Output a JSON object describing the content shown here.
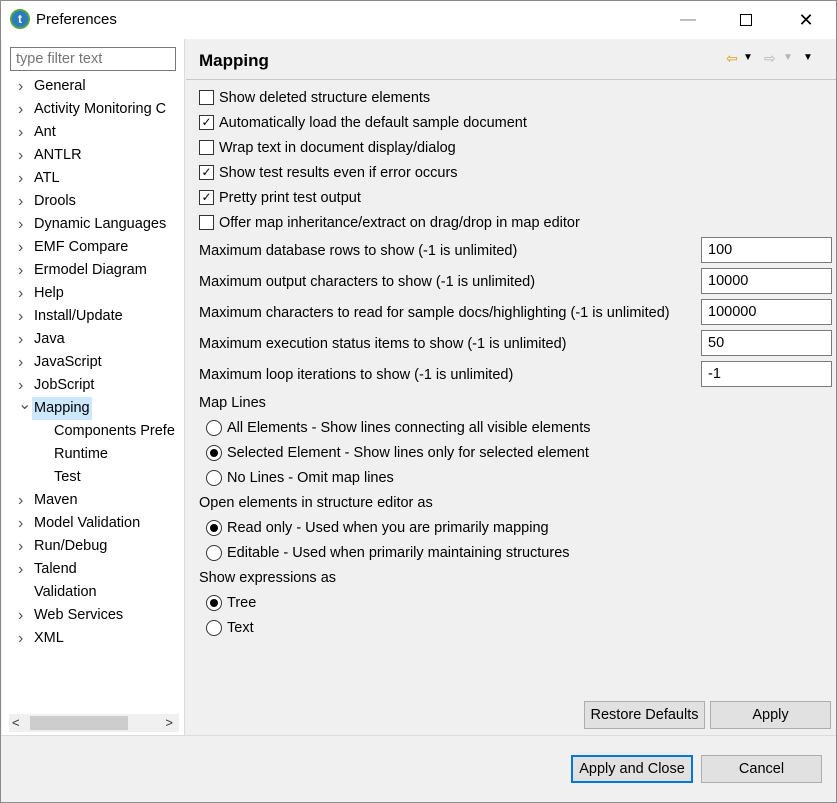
{
  "window": {
    "title": "Preferences",
    "app_icon": "t"
  },
  "filter": {
    "placeholder": "type filter text"
  },
  "tree": [
    {
      "label": "General",
      "expanded": false
    },
    {
      "label": "Activity Monitoring C",
      "expanded": false
    },
    {
      "label": "Ant",
      "expanded": false
    },
    {
      "label": "ANTLR",
      "expanded": false
    },
    {
      "label": "ATL",
      "expanded": false
    },
    {
      "label": "Drools",
      "expanded": false
    },
    {
      "label": "Dynamic Languages",
      "expanded": false
    },
    {
      "label": "EMF Compare",
      "expanded": false
    },
    {
      "label": "Ermodel Diagram",
      "expanded": false
    },
    {
      "label": "Help",
      "expanded": false
    },
    {
      "label": "Install/Update",
      "expanded": false
    },
    {
      "label": "Java",
      "expanded": false
    },
    {
      "label": "JavaScript",
      "expanded": false
    },
    {
      "label": "JobScript",
      "expanded": false
    },
    {
      "label": "Mapping",
      "expanded": true,
      "selected": true
    },
    {
      "label": "Components Prefe",
      "child": true
    },
    {
      "label": "Runtime",
      "child": true
    },
    {
      "label": "Test",
      "child": true
    },
    {
      "label": "Maven",
      "expanded": false
    },
    {
      "label": "Model Validation",
      "expanded": false
    },
    {
      "label": "Run/Debug",
      "expanded": false
    },
    {
      "label": "Talend",
      "expanded": false
    },
    {
      "label": "Validation",
      "leaf": true
    },
    {
      "label": "Web Services",
      "expanded": false
    },
    {
      "label": "XML",
      "expanded": false
    }
  ],
  "page": {
    "title": "Mapping",
    "checkboxes": [
      {
        "label": "Show deleted structure elements",
        "checked": false
      },
      {
        "label": "Automatically load the default sample document",
        "checked": true
      },
      {
        "label": "Wrap text in document display/dialog",
        "checked": false
      },
      {
        "label": "Show test results even if error occurs",
        "checked": true
      },
      {
        "label": "Pretty print test output",
        "checked": true
      },
      {
        "label": "Offer map inheritance/extract on drag/drop in map editor",
        "checked": false
      }
    ],
    "fields": [
      {
        "label": "Maximum database rows to show (-1 is unlimited)",
        "value": "100"
      },
      {
        "label": "Maximum output characters to show (-1 is unlimited)",
        "value": "10000"
      },
      {
        "label": "Maximum characters to read for sample docs/highlighting (-1 is unlimited)",
        "value": "100000"
      },
      {
        "label": "Maximum execution status items to show (-1 is unlimited)",
        "value": "50"
      },
      {
        "label": "Maximum loop iterations to show (-1 is unlimited)",
        "value": "-1"
      }
    ],
    "map_lines": {
      "label": "Map Lines",
      "options": [
        {
          "label": "All Elements - Show lines connecting all visible elements",
          "selected": false
        },
        {
          "label": "Selected Element - Show lines only for selected element",
          "selected": true
        },
        {
          "label": "No Lines - Omit map lines",
          "selected": false
        }
      ]
    },
    "open_elements": {
      "label": "Open elements in structure editor as",
      "options": [
        {
          "label": "Read only - Used when you are primarily mapping",
          "selected": true
        },
        {
          "label": "Editable - Used when primarily maintaining structures",
          "selected": false
        }
      ]
    },
    "show_expressions": {
      "label": "Show expressions as",
      "options": [
        {
          "label": "Tree",
          "selected": true
        },
        {
          "label": "Text",
          "selected": false
        }
      ]
    },
    "restore_defaults": "Restore Defaults",
    "apply": "Apply"
  },
  "footer": {
    "apply_close": "Apply and Close",
    "cancel": "Cancel"
  },
  "colors": {
    "selection": "#cce8ff",
    "accent": "#0078d7",
    "back_arrow": "#d4a017"
  }
}
